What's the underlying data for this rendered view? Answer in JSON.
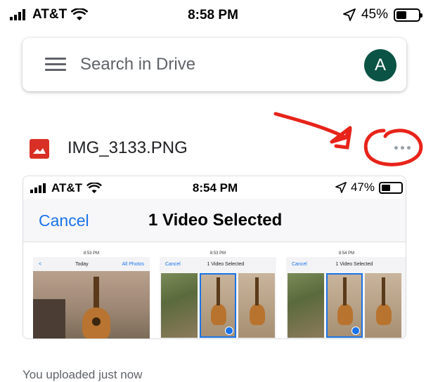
{
  "status_bar": {
    "carrier": "AT&T",
    "time": "8:58 PM",
    "battery": "45%",
    "battery_level": 0.45
  },
  "search": {
    "placeholder": "Search in Drive",
    "avatar_letter": "A"
  },
  "file": {
    "name": "IMG_3133.PNG"
  },
  "preview": {
    "status_bar": {
      "carrier": "AT&T",
      "time": "8:54 PM",
      "battery": "47%",
      "battery_level": 0.47
    },
    "cancel_label": "Cancel",
    "title": "1 Video Selected",
    "thumbnails": [
      {
        "time": "8:53 PM",
        "left": "Today",
        "right": "All Photos"
      },
      {
        "time": "8:53 PM",
        "left": "Cancel",
        "right": "1 Video Selected"
      },
      {
        "time": "8:54 PM",
        "left": "Cancel",
        "right": "1 Video Selected"
      }
    ]
  },
  "activity": "You uploaded just now",
  "colors": {
    "accent_blue": "#1a73e8",
    "avatar_bg": "#0b5345",
    "image_icon": "#d93025",
    "annotation": "#e8231a"
  }
}
